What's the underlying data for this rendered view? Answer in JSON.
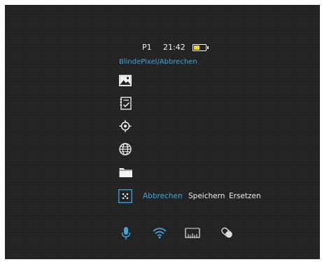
{
  "status_bar": {
    "profile": "P1",
    "time": "21:42",
    "battery_fill_fraction": 0.5,
    "battery_color": "#f5dc1a"
  },
  "menu": {
    "title": "BlindePixel/Abbrechen",
    "items": [
      {
        "icon": "image-icon"
      },
      {
        "icon": "notebook-check-icon"
      },
      {
        "icon": "crosshair-icon"
      },
      {
        "icon": "globe-icon"
      },
      {
        "icon": "folder-icon"
      },
      {
        "icon": "dead-pixel-icon"
      }
    ]
  },
  "bad_pixel_options": {
    "selected": "Abbrechen",
    "options": [
      "Abbrechen",
      "Speichern",
      "Ersetzen"
    ]
  },
  "bottom_icons": [
    {
      "icon": "microphone-icon",
      "color": "#3ea7e0"
    },
    {
      "icon": "wifi-icon",
      "color": "#3ea7e0"
    },
    {
      "icon": "ruler-icon",
      "color": "#dddddd"
    },
    {
      "icon": "pill-icon",
      "color": "#dddddd"
    }
  ],
  "colors": {
    "accent": "#3ea7e0",
    "background": "#222222",
    "text": "#eeeeee"
  }
}
